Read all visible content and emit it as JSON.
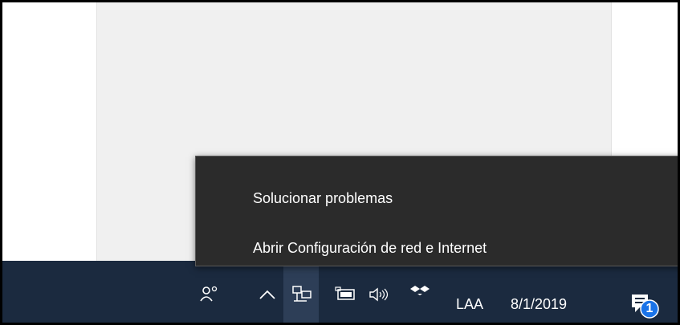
{
  "context_menu": {
    "items": [
      {
        "label": "Solucionar problemas"
      },
      {
        "label": "Abrir Configuración de red e Internet"
      }
    ]
  },
  "taskbar": {
    "icons": [
      "people-icon",
      "chevron-up-icon",
      "network-icon",
      "battery-icon",
      "volume-icon",
      "dropbox-icon"
    ],
    "language": "LAA",
    "date": "8/1/2019",
    "notification_count": "1"
  },
  "colors": {
    "menu_bg": "#2b2b2b",
    "taskbar_bg": "#1b2a3f",
    "badge": "#1a73e8"
  }
}
